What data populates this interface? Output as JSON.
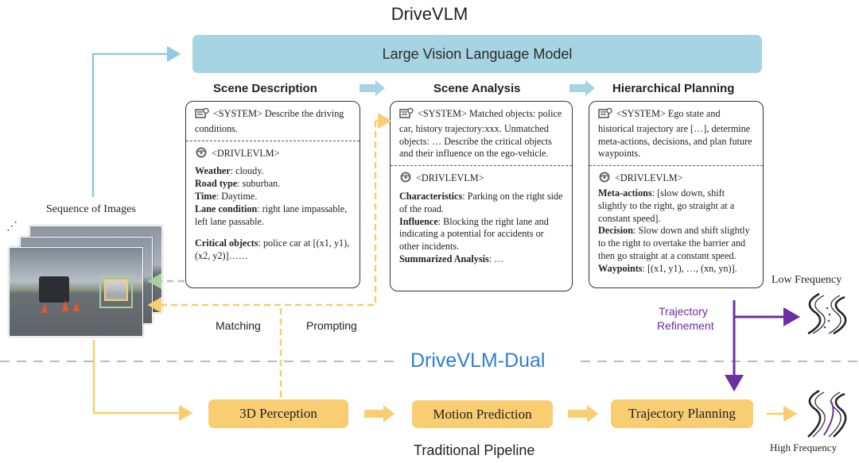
{
  "title": "DriveVLM",
  "lvlm_label": "Large Vision Language Model",
  "stages": {
    "scene_description": "Scene Description",
    "scene_analysis": "Scene Analysis",
    "hierarchical_planning": "Hierarchical Planning"
  },
  "boxes": {
    "description": {
      "system": "<SYSTEM> Describe the driving conditions.",
      "model_tag": "<DRIVLEVLM>",
      "fields": [
        {
          "key": "Weather",
          "value": ": cloudy."
        },
        {
          "key": "Road type",
          "value": ": suburban."
        },
        {
          "key": "Time",
          "value": ": Daytime."
        },
        {
          "key": "Lane condition",
          "value": ": right lane impassable, left lane passable."
        },
        {
          "key": "Critical objects",
          "value": ": police car at [(x1, y1), (x2, y2)]……"
        }
      ]
    },
    "analysis": {
      "system": "<SYSTEM> Matched objects: police car, history trajectory:xxx. Unmatched objects: … Describe the critical objects and their influence on the ego-vehicle.",
      "model_tag": "<DRIVLEVLM>",
      "fields": [
        {
          "key": "Characteristics",
          "value": ": Parking on the right side of the road."
        },
        {
          "key": "Influence",
          "value": ": Blocking the right lane and indicating a potential for accidents or other incidents."
        },
        {
          "key": "Summarized Analysis",
          "value": ": …"
        }
      ]
    },
    "planning": {
      "system": "<SYSTEM> Ego state and historical trajectory are […], determine meta-actions, decisions, and plan future waypoints.",
      "model_tag": "<DRIVLEVLM>",
      "fields": [
        {
          "key": "Meta-actions",
          "value": ": [slow down, shift slightly to the right, go straight at a constant speed]."
        },
        {
          "key": "Decision",
          "value": ": Slow down and shift slightly to the right to overtake the barrier and then go straight at a constant speed."
        },
        {
          "key": "Waypoints",
          "value": ": [(x1, y1), …, (xn, yn)]."
        }
      ]
    }
  },
  "left": {
    "sequence_label": "Sequence of Images",
    "ellipsis": "⋰"
  },
  "labels": {
    "matching": "Matching",
    "prompting": "Prompting",
    "dual": "DriveVLM-Dual",
    "trajectory_refinement_1": "Trajectory",
    "trajectory_refinement_2": "Refinement",
    "low_frequency": "Low Frequency",
    "high_frequency": "High Frequency",
    "traditional_pipeline": "Traditional Pipeline"
  },
  "pipeline": [
    "3D Perception",
    "Motion Prediction",
    "Trajectory Planning"
  ],
  "colors": {
    "lvlm": "#a6d4e2",
    "blue_arrow": "#8ecbe0",
    "orange": "#f9cd72",
    "purple": "#6b2fa0",
    "dual_blue": "#2f7fd0",
    "green": "#a8cfa0"
  }
}
